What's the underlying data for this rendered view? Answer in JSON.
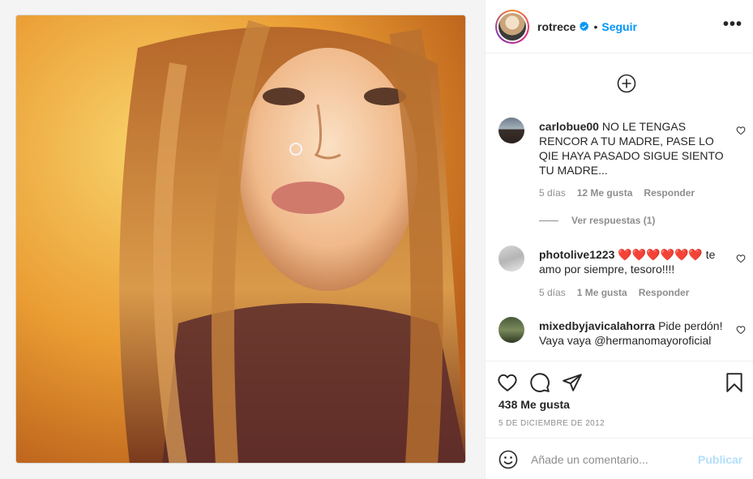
{
  "post": {
    "author": "rotrece",
    "follow_label": "Seguir",
    "separator": "•"
  },
  "comments": [
    {
      "user": "carlobue00",
      "text": "NO LE TENGAS RENCOR A TU MADRE, PASE LO QIE HAYA PASADO SIGUE SIENTO TU MADRE...",
      "time": "5 días",
      "likes": "12 Me gusta",
      "reply": "Responder",
      "view_replies": "Ver respuestas (1)"
    },
    {
      "user": "photolive1223",
      "text": "❤️❤️❤️❤️❤️❤️ te amo por siempre, tesoro!!!!",
      "time": "5 días",
      "likes": "1 Me gusta",
      "reply": "Responder"
    },
    {
      "user": "mixedbyjavicalahorra",
      "text": "Pide perdón! Vaya vaya @hermanomayoroficial"
    }
  ],
  "footer": {
    "likes": "438 Me gusta",
    "date": "5 DE DICIEMBRE DE 2012",
    "comment_placeholder": "Añade un comentario...",
    "publish_label": "Publicar"
  },
  "colors": {
    "accent": "#0095f6",
    "publish_disabled": "#b2dffc",
    "muted": "#8e8e8e"
  },
  "icons": [
    "heart-icon",
    "comment-icon",
    "share-icon",
    "bookmark-icon",
    "emoji-icon",
    "plus-circle-icon",
    "verified-badge-icon",
    "more-options-icon"
  ]
}
